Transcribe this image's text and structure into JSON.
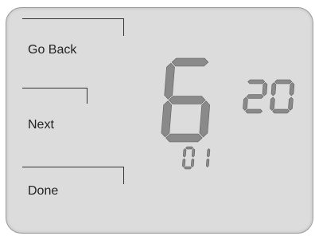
{
  "softkeys": {
    "back_label": "Go Back",
    "next_label": "Next",
    "done_label": "Done"
  },
  "display": {
    "main_value": "6",
    "secondary_value": "20",
    "tertiary_value": "01"
  },
  "colors": {
    "screen_bg": "#dcdcdc",
    "segment_fill": "#8a8a8a",
    "border": "#9a9a9a"
  }
}
